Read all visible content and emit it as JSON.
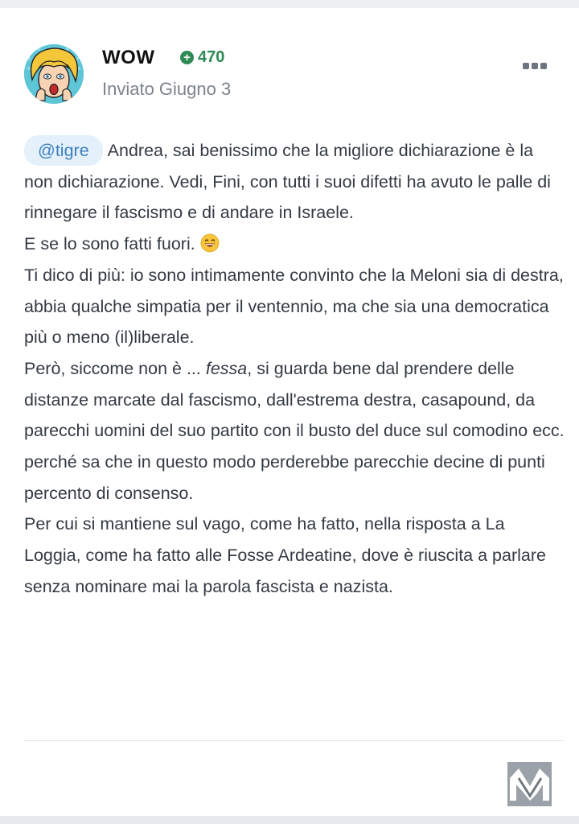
{
  "post": {
    "author": "WOW",
    "reputation": "470",
    "reputation_icon": "plus-circle-icon",
    "date": "Inviato Giugno 3",
    "menu_icon": "more-options-icon",
    "colors": {
      "reputation": "#2e8a55",
      "mention_bg": "#e4f1fb",
      "mention_text": "#3d7fbf"
    }
  },
  "content": {
    "mention": "@tigre",
    "line1": "Andrea, sai benissimo che la migliore dichiarazione è la non dichiarazione. Vedi, Fini, con tutti i suoi difetti ha avuto le palle di rinnegare il fascismo e di andare in Israele.",
    "line2": "E se lo sono fatti fuori.",
    "emoji": "grinning-face-emoji",
    "line3": "Ti dico di più: io sono intimamente convinto che la Meloni sia di destra, abbia qualche simpatia per il ventennio, ma che sia una democratica più o meno (il)liberale.",
    "line4_before": "Però, siccome non è ... ",
    "line4_italic": "fessa",
    "line4_after": ", si guarda bene dal prendere delle distanze marcate dal fascismo, dall'estrema destra, casapound, da parecchi uomini del suo partito con il busto del duce sul comodino ecc. perché sa che in questo modo perderebbe parecchie decine di punti percento di consenso.",
    "line5": "Per cui si mantiene sul vago, come ha fatto, nella risposta a La Loggia, come ha fatto alle Fosse Ardeatine, dove è riuscita a parlare senza nominare mai la parola fascista e nazista."
  },
  "footer": {
    "logo_icon": "site-logo-icon"
  }
}
